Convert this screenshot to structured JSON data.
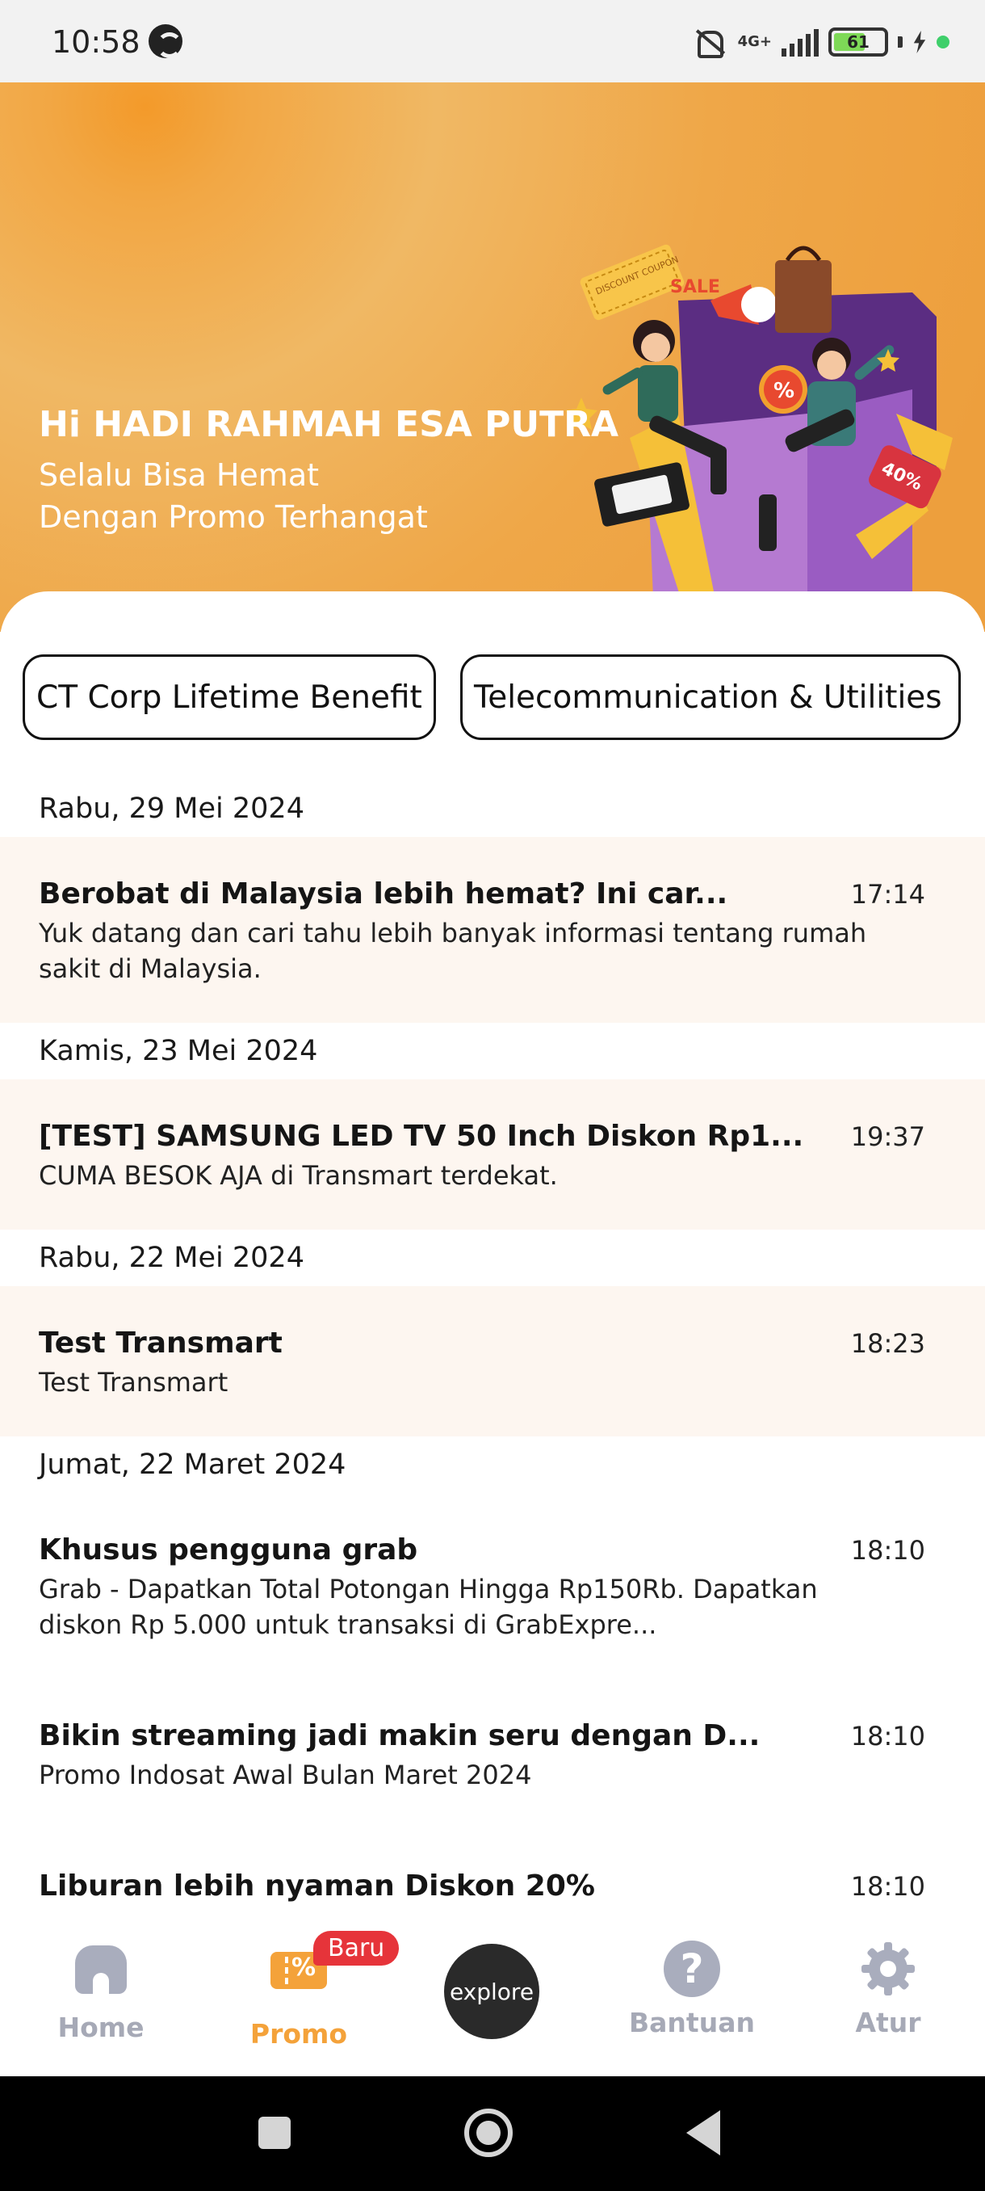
{
  "status_bar": {
    "time": "10:58",
    "network": "4G+",
    "battery": "61"
  },
  "banner": {
    "greeting": "Hi HADI RAHMAH ESA PUTRA",
    "tagline_line1": "Selalu Bisa Hemat",
    "tagline_line2": "Dengan Promo Terhangat",
    "illustration_text": {
      "coupon": "DISCOUNT COUPON",
      "sale": "SALE",
      "tag": "40%"
    }
  },
  "chips": [
    {
      "label": "CT Corp Lifetime Benefit"
    },
    {
      "label": "Telecommunication & Utilities"
    }
  ],
  "feed": [
    {
      "date": "Rabu, 29 Mei 2024",
      "items": [
        {
          "title": "Berobat di Malaysia lebih hemat? Ini car...",
          "body": "Yuk datang dan cari tahu lebih banyak informasi tentang rumah sakit di Malaysia.",
          "time": "17:14"
        }
      ]
    },
    {
      "date": "Kamis, 23 Mei 2024",
      "items": [
        {
          "title": "[TEST] SAMSUNG LED TV 50 Inch Diskon Rp1...",
          "body": "CUMA BESOK AJA di Transmart terdekat.",
          "time": "19:37"
        }
      ]
    },
    {
      "date": "Rabu, 22 Mei 2024",
      "items": [
        {
          "title": "Test Transmart",
          "body": "Test Transmart",
          "time": "18:23"
        }
      ]
    },
    {
      "date": "Jumat, 22 Maret 2024",
      "items": [
        {
          "title": "Khusus pengguna grab",
          "body": "Grab - Dapatkan Total Potongan Hingga Rp150Rb. Dapatkan diskon Rp 5.000 untuk transaksi di GrabExpre...",
          "time": "18:10"
        },
        {
          "title": "Bikin streaming jadi makin seru dengan D...",
          "body": "Promo Indosat Awal Bulan Maret 2024",
          "time": "18:10"
        },
        {
          "title": "Liburan lebih nyaman Diskon 20%",
          "body": "",
          "time": "18:10"
        }
      ]
    }
  ],
  "bottom_nav": {
    "home": "Home",
    "promo": "Promo",
    "promo_badge": "Baru",
    "explore": "explore",
    "help": "Bantuan",
    "settings": "Atur",
    "active_color": "#f4a23a",
    "inactive_color": "#a6a9b6"
  }
}
